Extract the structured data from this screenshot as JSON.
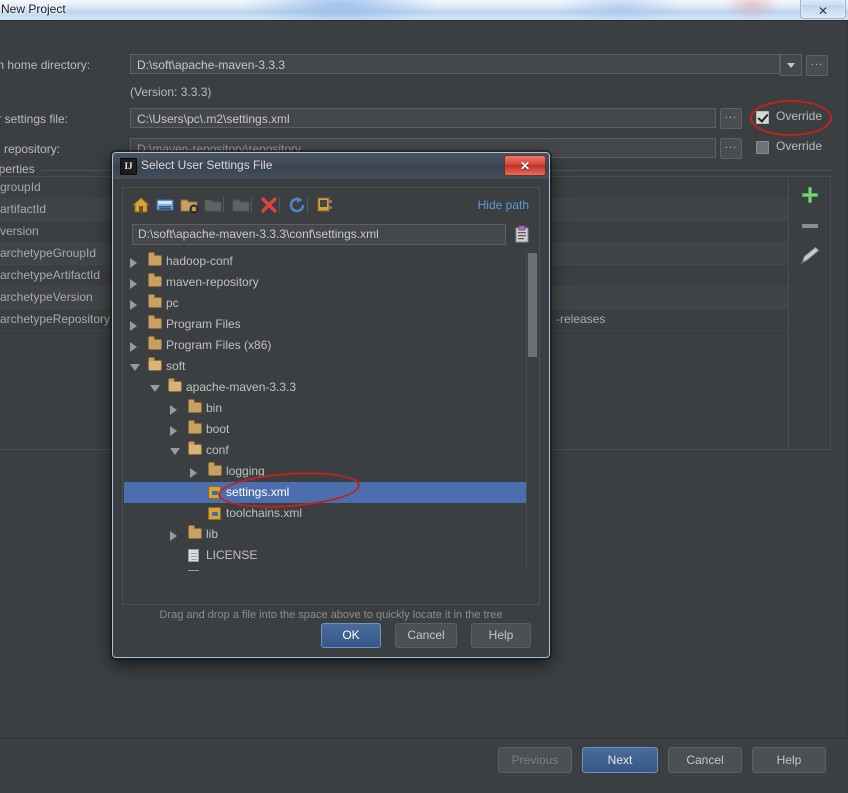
{
  "os_window": {
    "title": "New Project",
    "close_label": "✕"
  },
  "wizard": {
    "fields": [
      {
        "label": "Maven home directory:",
        "label_prefix": "M",
        "value": "D:\\soft\\apache-maven-3.3.3"
      },
      {
        "label": "User settings file:",
        "value": "C:\\Users\\pc\\.m2\\settings.xml"
      },
      {
        "label": "Local repository:",
        "value": "D:\\maven-repository\\repository"
      }
    ],
    "version_note": "(Version: 3.3.3)",
    "browse_label": "...",
    "overrides": [
      {
        "label": "Override",
        "checked": true
      },
      {
        "label": "Override",
        "checked": false
      }
    ],
    "properties_legend": "Properties",
    "property_rows": [
      {
        "key": "groupId",
        "value": ""
      },
      {
        "key": "artifactId",
        "value": ""
      },
      {
        "key": "version",
        "value": ""
      },
      {
        "key": "archetypeGroupId",
        "value": ""
      },
      {
        "key": "archetypeArtifactId",
        "value": ""
      },
      {
        "key": "archetypeVersion",
        "value": ""
      },
      {
        "key": "archetypeRepository",
        "value": "-releases"
      }
    ],
    "side_buttons": [
      {
        "name": "add",
        "glyph": "+"
      },
      {
        "name": "remove",
        "glyph": "–"
      },
      {
        "name": "edit",
        "glyph": "✎"
      }
    ],
    "buttons": [
      {
        "label": "Previous",
        "state": "disabled"
      },
      {
        "label": "Next",
        "state": "default"
      },
      {
        "label": "Cancel",
        "state": "normal"
      },
      {
        "label": "Help",
        "state": "normal"
      }
    ]
  },
  "dialog": {
    "icon_text": "IJ",
    "title": "Select User Settings File",
    "close_label": "✕",
    "toolbar": [
      {
        "name": "home-icon",
        "enabled": true
      },
      {
        "name": "desktop-icon",
        "enabled": true
      },
      {
        "name": "new-folder-icon",
        "enabled": true
      },
      {
        "name": "folder-up-icon",
        "enabled": false
      },
      {
        "name": "folder-icon",
        "enabled": false
      },
      {
        "name": "delete-icon",
        "enabled": true
      },
      {
        "name": "refresh-icon",
        "enabled": true
      },
      {
        "name": "show-hidden-files-icon",
        "enabled": true
      }
    ],
    "hide_path_label": "Hide path",
    "path_value": "D:\\soft\\apache-maven-3.3.3\\conf\\settings.xml",
    "tree": [
      {
        "label": "hadoop-conf",
        "depth": 1,
        "type": "folder",
        "toggle": "collapsed",
        "selected": false
      },
      {
        "label": "maven-repository",
        "depth": 1,
        "type": "folder",
        "toggle": "collapsed",
        "selected": false
      },
      {
        "label": "pc",
        "depth": 1,
        "type": "folder",
        "toggle": "collapsed",
        "selected": false
      },
      {
        "label": "Program Files",
        "depth": 1,
        "type": "folder",
        "toggle": "collapsed",
        "selected": false
      },
      {
        "label": "Program Files (x86)",
        "depth": 1,
        "type": "folder",
        "toggle": "collapsed",
        "selected": false
      },
      {
        "label": "soft",
        "depth": 1,
        "type": "folder",
        "toggle": "expanded",
        "selected": false
      },
      {
        "label": "apache-maven-3.3.3",
        "depth": 2,
        "type": "folder",
        "toggle": "expanded",
        "selected": false
      },
      {
        "label": "bin",
        "depth": 3,
        "type": "folder",
        "toggle": "collapsed",
        "selected": false
      },
      {
        "label": "boot",
        "depth": 3,
        "type": "folder",
        "toggle": "collapsed",
        "selected": false
      },
      {
        "label": "conf",
        "depth": 3,
        "type": "folder",
        "toggle": "expanded",
        "selected": false
      },
      {
        "label": "logging",
        "depth": 4,
        "type": "folder",
        "toggle": "collapsed",
        "selected": false
      },
      {
        "label": "settings.xml",
        "depth": 4,
        "type": "xml",
        "toggle": "none",
        "selected": true
      },
      {
        "label": "toolchains.xml",
        "depth": 4,
        "type": "xml",
        "toggle": "none",
        "selected": false
      },
      {
        "label": "lib",
        "depth": 3,
        "type": "folder",
        "toggle": "collapsed",
        "selected": false
      },
      {
        "label": "LICENSE",
        "depth": 3,
        "type": "doc",
        "toggle": "none",
        "selected": false
      },
      {
        "label": "NOTICE",
        "depth": 3,
        "type": "doc",
        "toggle": "none",
        "selected": false
      }
    ],
    "dnd_hint": "Drag and drop a file into the space above to quickly locate it in the tree",
    "buttons": [
      {
        "label": "OK",
        "state": "default"
      },
      {
        "label": "Cancel",
        "state": "normal"
      },
      {
        "label": "Help",
        "state": "normal"
      }
    ]
  },
  "colors": {
    "background": "#3c3f41",
    "selection": "#4b6eaf",
    "accent_link": "#5b9bd5",
    "marker_red": "#c0231e",
    "default_button": "#4a6c9b",
    "add_green": "#4aa84a",
    "close_red": "#d4483a"
  }
}
